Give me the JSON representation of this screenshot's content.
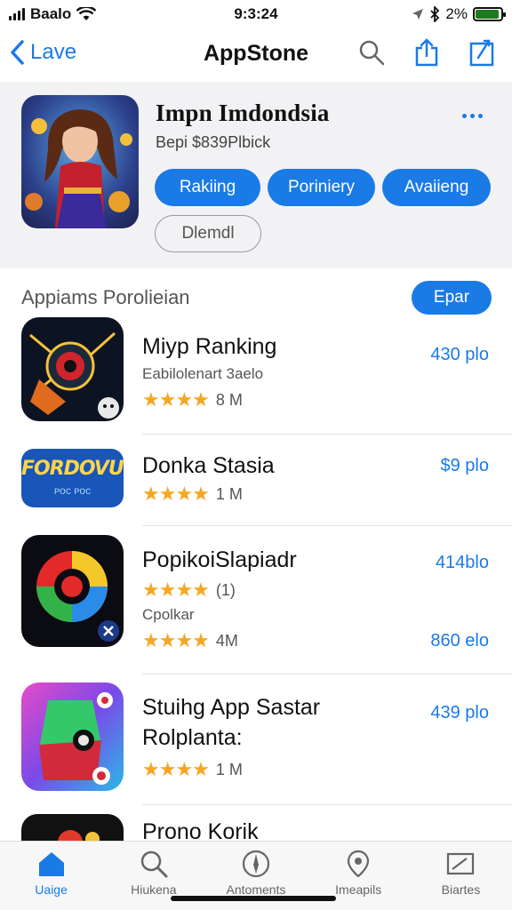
{
  "status_bar": {
    "carrier": "Baalo",
    "time": "9:3:24",
    "battery": "2%"
  },
  "nav": {
    "back_label": "Lave",
    "title": "AppStone"
  },
  "featured": {
    "name": "Impn Imdondsia",
    "subtitle": "Bepi $839Plbick",
    "buttons": [
      "Rakiing",
      "Poriniery",
      "Avaiieng"
    ],
    "secondary_button": "Dlemdl"
  },
  "section": {
    "title": "Appiams Porolieian",
    "action": "Epar"
  },
  "apps": [
    {
      "name": "Miyp Ranking",
      "subtitle": "Eabilolenart 3aelo",
      "rating_count": "8 M",
      "price": "430 plo",
      "icon": "arcade-icon"
    },
    {
      "name": "Donka Stasia",
      "rating_count": "1 M",
      "price": "$9 plo",
      "icon": "fordovun-logo-icon",
      "logo_text": "FORDOVUN",
      "logo_sub": "ᴘᴏᴄ ᴘᴏᴄ"
    },
    {
      "name": "PopikoiSlapiadr",
      "rating_extra": "(1)",
      "subtitle": "Cpolkar",
      "rating_count": "4M",
      "price": "414blo",
      "price_2": "860 elo",
      "icon": "spiral-icon"
    },
    {
      "name": "Stuihg App Sastar",
      "name_line2": "Rolplanta:",
      "rating_count": "1 M",
      "price": "439 plo",
      "icon": "puzzle-icon"
    },
    {
      "name": "Prono Korik",
      "price": ""
    }
  ],
  "tabs": [
    {
      "label": "Uaige",
      "icon": "home-icon"
    },
    {
      "label": "Hiukena",
      "icon": "search-icon"
    },
    {
      "label": "Antoments",
      "icon": "compass-icon"
    },
    {
      "label": "Imeapils",
      "icon": "location-icon"
    },
    {
      "label": "Biartes",
      "icon": "chart-icon"
    }
  ],
  "colors": {
    "accent": "#1a7ae6",
    "star": "#f6a623"
  }
}
